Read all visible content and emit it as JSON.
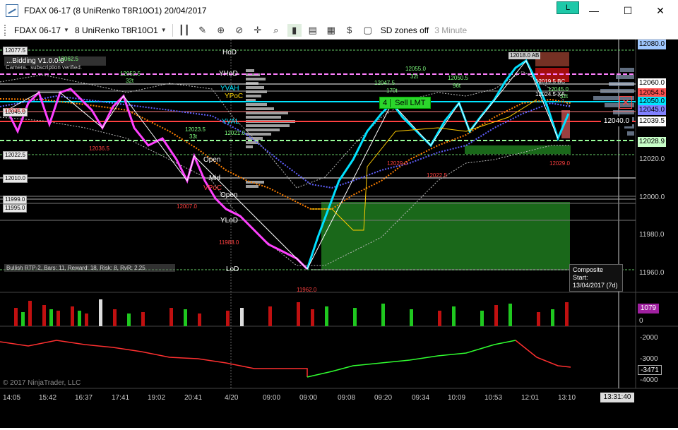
{
  "window": {
    "title": "FDAX 06-17 (8 UniRenko T8R10O1)  20/04/2017",
    "badge": "L",
    "minimize": "—",
    "maximize": "☐",
    "close": "✕"
  },
  "toolbar": {
    "instrument": "FDAX 06-17",
    "bar_type": "8 UniRenko T8R10O1",
    "sd_zones": "SD zones off",
    "timeframe": "3 Minute"
  },
  "overlays": {
    "level_labels": [
      "HoD",
      "YHoD",
      "YVAH",
      "YPoC",
      "YVAL",
      "Open",
      "Mid",
      "Open",
      "YLoD",
      "LoD",
      "VPoC"
    ],
    "left_labels": [
      "12077.5",
      "12045.0",
      "12022.5",
      "12010.0",
      "11999.0",
      "11995.0"
    ],
    "strategy_text": "...Bidding V1.0.0.0",
    "strategy_sub": "Camera.. subscription verified.",
    "stats_box": "Bullish RTP-2, Bars: 11, Reward: 18, Risk: 8, RvR: 2.25",
    "point_labels": [
      {
        "text": "12062.5"
      },
      {
        "text": "12052.5"
      },
      {
        "text": "32t"
      },
      {
        "text": "12023.5"
      },
      {
        "text": "33t"
      },
      {
        "text": "12021.0"
      },
      {
        "text": "12055.0"
      },
      {
        "text": "32t"
      },
      {
        "text": "12047.5"
      },
      {
        "text": "170t"
      },
      {
        "text": "12050.5"
      },
      {
        "text": "96t"
      },
      {
        "text": "12045.0"
      },
      {
        "text": "32t"
      }
    ],
    "low_labels": [
      {
        "text": "12045.0"
      },
      {
        "text": "12036.5"
      },
      {
        "text": "12007.0"
      },
      {
        "text": "11988.0"
      },
      {
        "text": "12029.0"
      },
      {
        "text": "12022.5"
      },
      {
        "text": "12029.0"
      },
      {
        "text": "11962.0"
      }
    ],
    "zone_labels": [
      "12018.0 AB",
      "12019.5 BC",
      "12024.5 XA"
    ]
  },
  "order": {
    "quantity": "4",
    "label": "Sell LMT",
    "cancel": "✕"
  },
  "price_axis": {
    "ticks": [
      "12080.0",
      "12060.0",
      "12040.0",
      "12020.0",
      "12000.0",
      "11980.0",
      "11960.0"
    ],
    "tags": [
      {
        "value": "12080.0",
        "color": "#a0c8ff"
      },
      {
        "value": "12060.0",
        "color": "#ffffff"
      },
      {
        "value": "12054.5",
        "color": "#ff5050"
      },
      {
        "value": "12050.0",
        "color": "#00e5ff"
      },
      {
        "value": "12045.0",
        "color": "#8080ff"
      },
      {
        "value": "12039.5",
        "color": "#ffffff"
      },
      {
        "value": "12028.9",
        "color": "#c8ffc8"
      }
    ],
    "last_inner": "12040.0"
  },
  "composite": {
    "title": "Composite Start:",
    "date": "13/04/2017 (7d)"
  },
  "volume": {
    "value": "1079",
    "zero": "0"
  },
  "indicator": {
    "ticks": [
      "-2000",
      "-3000",
      "-4000"
    ],
    "value": "-3471"
  },
  "time_axis": {
    "labels": [
      "14:05",
      "15:42",
      "16:37",
      "17:41",
      "19:02",
      "20:41",
      "4/20",
      "09:00",
      "09:00",
      "09:08",
      "09:20",
      "09:34",
      "10:09",
      "10:53",
      "12:01",
      "13:10"
    ],
    "current": "13:31:40"
  },
  "footer": {
    "copyright": "© 2017 NinjaTrader, LLC"
  },
  "colors": {
    "bull": "#00e0ff",
    "bear": "#ff40ff",
    "vwap_up": "#ff8000",
    "vwap_dn": "#6060ff",
    "hod": "#a0c8ff",
    "zone_green": "#1f7a1f",
    "zone_red": "#c01010"
  }
}
